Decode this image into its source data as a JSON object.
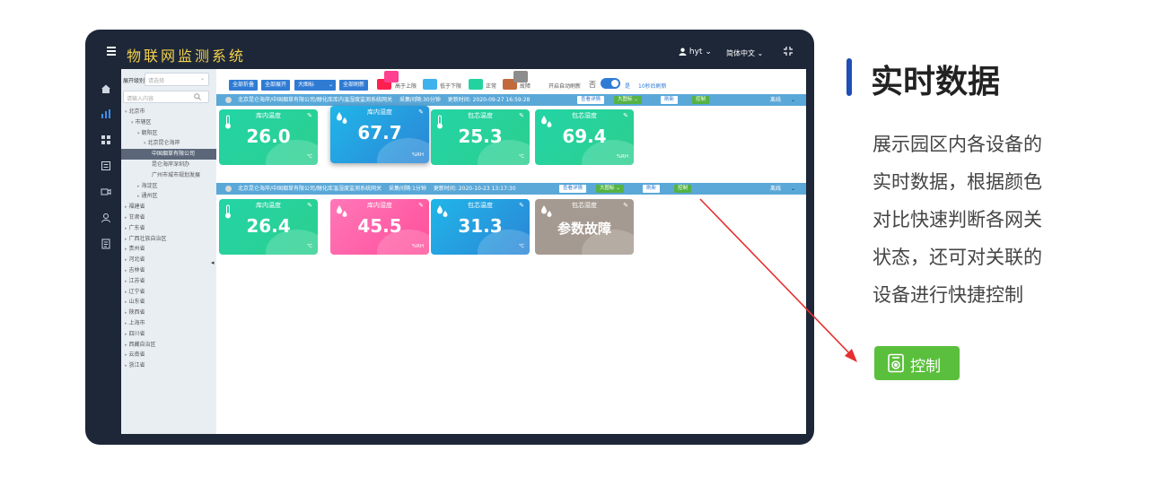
{
  "app": {
    "title": "物联网监测系统",
    "user": "hyt",
    "language": "简体中文"
  },
  "tree": {
    "expand_label": "展开级别",
    "select_placeholder": "请选择",
    "search_placeholder": "请输入内容",
    "items": [
      {
        "label": "北京市",
        "level": 1,
        "arrow": "▾"
      },
      {
        "label": "市辖区",
        "level": 2,
        "arrow": "▾"
      },
      {
        "label": "朝阳区",
        "level": 3,
        "arrow": "▾"
      },
      {
        "label": "北京昆仑海岸",
        "level": 4,
        "arrow": "▾"
      },
      {
        "label": "中国烟草有限公司",
        "level": 5,
        "arrow": "",
        "selected": true
      },
      {
        "label": "昆仑海岸深圳办",
        "level": 5,
        "arrow": ""
      },
      {
        "label": "广州市城市规划发展",
        "level": 5,
        "arrow": ""
      },
      {
        "label": "海淀区",
        "level": 3,
        "arrow": "▸"
      },
      {
        "label": "通州区",
        "level": 3,
        "arrow": "▸"
      },
      {
        "label": "福建省",
        "level": 1,
        "arrow": "▸"
      },
      {
        "label": "甘肃省",
        "level": 1,
        "arrow": "▸"
      },
      {
        "label": "广东省",
        "level": 1,
        "arrow": "▸"
      },
      {
        "label": "广西壮族自治区",
        "level": 1,
        "arrow": "▸"
      },
      {
        "label": "贵州省",
        "level": 1,
        "arrow": "▸"
      },
      {
        "label": "河北省",
        "level": 1,
        "arrow": "▸"
      },
      {
        "label": "吉林省",
        "level": 1,
        "arrow": "▸"
      },
      {
        "label": "江苏省",
        "level": 1,
        "arrow": "▸"
      },
      {
        "label": "辽宁省",
        "level": 1,
        "arrow": "▸"
      },
      {
        "label": "山东省",
        "level": 1,
        "arrow": "▸"
      },
      {
        "label": "陕西省",
        "level": 1,
        "arrow": "▸"
      },
      {
        "label": "上海市",
        "level": 1,
        "arrow": "▸"
      },
      {
        "label": "四川省",
        "level": 1,
        "arrow": "▸"
      },
      {
        "label": "西藏自治区",
        "level": 1,
        "arrow": "▸"
      },
      {
        "label": "云南省",
        "level": 1,
        "arrow": "▸"
      },
      {
        "label": "浙江省",
        "level": 1,
        "arrow": "▸"
      }
    ]
  },
  "toolbar": {
    "collapse_all": "全部折叠",
    "expand_all": "全部展开",
    "icon_size": "大图标",
    "refresh_all": "全部刷新",
    "legend": [
      {
        "label": "高于上限",
        "color": "#ff2d6f"
      },
      {
        "label": "低于下限",
        "color": "#3fb2ee"
      },
      {
        "label": "正常",
        "color": "#22d3a0"
      },
      {
        "label": "故障",
        "color": "#8c8c8c"
      }
    ],
    "auto_refresh_label": "开启自动刷新",
    "auto_refresh_off": "否",
    "auto_refresh_on": "是",
    "refresh_interval": "10秒后刷新"
  },
  "gateways": [
    {
      "path": "北京昆仑海岸/中国烟草有限公司/醇化库库内温湿度监测系统网关",
      "interval": "采集间隔:30分钟",
      "updated": "更新时间: 2020-09-27 16:59:28",
      "detail": "查看详情",
      "size": "大图标",
      "action": "刷新",
      "control": "控制",
      "status": "离线",
      "cards": [
        {
          "title": "库内温度",
          "value": "26.0",
          "unit": "℃",
          "style": "green",
          "icon": "thermometer-icon"
        },
        {
          "title": "库内湿度",
          "value": "67.7",
          "unit": "%RH",
          "style": "blue",
          "icon": "humidity-icon"
        },
        {
          "title": "包芯温度",
          "value": "25.3",
          "unit": "℃",
          "style": "green",
          "icon": "thermometer-icon"
        },
        {
          "title": "包芯湿度",
          "value": "69.4",
          "unit": "%RH",
          "style": "green",
          "icon": "humidity-icon"
        }
      ]
    },
    {
      "path": "北京昆仑海岸/中国烟草有限公司/醇化库温湿度监测系统网关",
      "interval": "采集间隔:1分钟",
      "updated": "更新时间: 2020-10-23 13:17:30",
      "detail": "查看详情",
      "size": "大图标",
      "action": "刷新",
      "control": "控制",
      "status": "离线",
      "cards": [
        {
          "title": "库内温度",
          "value": "26.4",
          "unit": "℃",
          "style": "green",
          "icon": "thermometer-icon"
        },
        {
          "title": "库内湿度",
          "value": "45.5",
          "unit": "%RH",
          "style": "pink",
          "icon": "humidity-icon"
        },
        {
          "title": "包芯温度",
          "value": "31.3",
          "unit": "℃",
          "style": "blue",
          "icon": "humidity-icon"
        },
        {
          "title": "包芯湿度",
          "value": "参数故障",
          "unit": "",
          "style": "gray",
          "icon": "humidity-icon"
        }
      ]
    }
  ],
  "side": {
    "title": "实时数据",
    "desc_lines": [
      "展示园区内各设备的",
      "实时数据，根据颜色",
      "对比快速判断各网关",
      "状态，还可对关联的",
      "设备进行快捷控制"
    ],
    "control_label": "控制"
  },
  "colors": {
    "frame": "#1d2738",
    "accent": "#1f4fb4",
    "control": "#5abf3c",
    "arrow": "#e62e2e"
  }
}
